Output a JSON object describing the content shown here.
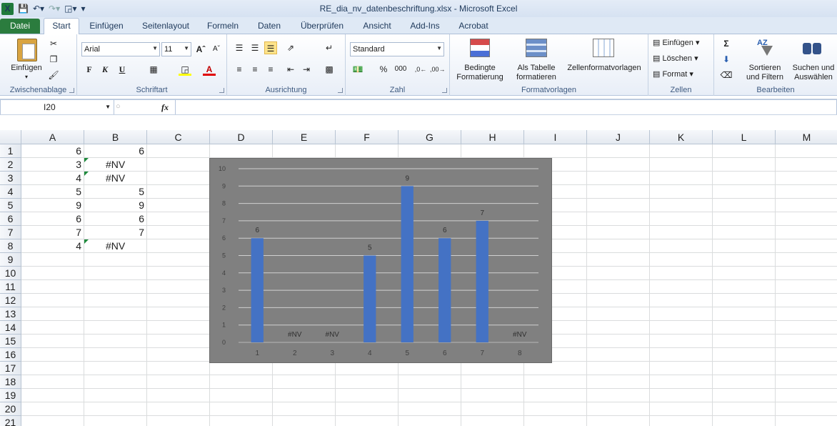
{
  "titlebar": {
    "title": "RE_dia_nv_datenbeschriftung.xlsx  -  Microsoft Excel",
    "logo": "X",
    "qat": [
      "save-icon",
      "undo-icon",
      "redo-icon",
      "fill-icon",
      "customize-icon"
    ]
  },
  "tabs": {
    "file": "Datei",
    "items": [
      "Start",
      "Einfügen",
      "Seitenlayout",
      "Formeln",
      "Daten",
      "Überprüfen",
      "Ansicht",
      "Add-Ins",
      "Acrobat"
    ]
  },
  "ribbon": {
    "clipboard": {
      "label": "Zwischenablage",
      "paste": "Einfügen"
    },
    "font": {
      "label": "Schriftart",
      "name": "Arial",
      "size": "11",
      "bold": "F",
      "italic": "K",
      "underline": "U"
    },
    "alignment": {
      "label": "Ausrichtung"
    },
    "number": {
      "label": "Zahl",
      "format": "Standard",
      "percent": "%",
      "thousands": "000"
    },
    "styles": {
      "label": "Formatvorlagen",
      "conditional_1": "Bedingte",
      "conditional_2": "Formatierung",
      "table_1": "Als Tabelle",
      "table_2": "formatieren",
      "cellstyles": "Zellenformatvorlagen"
    },
    "cells": {
      "label": "Zellen",
      "insert": "Einfügen",
      "delete": "Löschen",
      "format": "Format"
    },
    "editing": {
      "label": "Bearbeiten",
      "sort_1": "Sortieren",
      "sort_2": "und Filtern",
      "find_1": "Suchen und",
      "find_2": "Auswählen",
      "sigma": "Σ"
    }
  },
  "formula_bar": {
    "namebox": "I20",
    "fx": "fx",
    "value": ""
  },
  "sheet": {
    "columns": [
      "A",
      "B",
      "C",
      "D",
      "E",
      "F",
      "G",
      "H",
      "I",
      "J",
      "K",
      "L",
      "M"
    ],
    "rows": [
      "1",
      "2",
      "3",
      "4",
      "5",
      "6",
      "7",
      "8",
      "9",
      "10",
      "11",
      "12",
      "13",
      "14",
      "15",
      "16",
      "17",
      "18",
      "19",
      "20",
      "21"
    ],
    "colA": [
      "6",
      "3",
      "4",
      "5",
      "9",
      "6",
      "7",
      "4"
    ],
    "colB": [
      "6",
      "#NV",
      "#NV",
      "5",
      "9",
      "6",
      "7",
      "#NV"
    ]
  },
  "chart_data": {
    "type": "bar",
    "categories": [
      "1",
      "2",
      "3",
      "4",
      "5",
      "6",
      "7",
      "8"
    ],
    "values": [
      6,
      null,
      null,
      5,
      9,
      6,
      7,
      null
    ],
    "data_labels": [
      "6",
      "#NV",
      "#NV",
      "5",
      "9",
      "6",
      "7",
      "#NV"
    ],
    "ylim": [
      0,
      10
    ],
    "yticks": [
      "0",
      "1",
      "2",
      "3",
      "4",
      "5",
      "6",
      "7",
      "8",
      "9",
      "10"
    ],
    "grid": true,
    "bar_color": "#4472c4",
    "background": "#808080"
  }
}
